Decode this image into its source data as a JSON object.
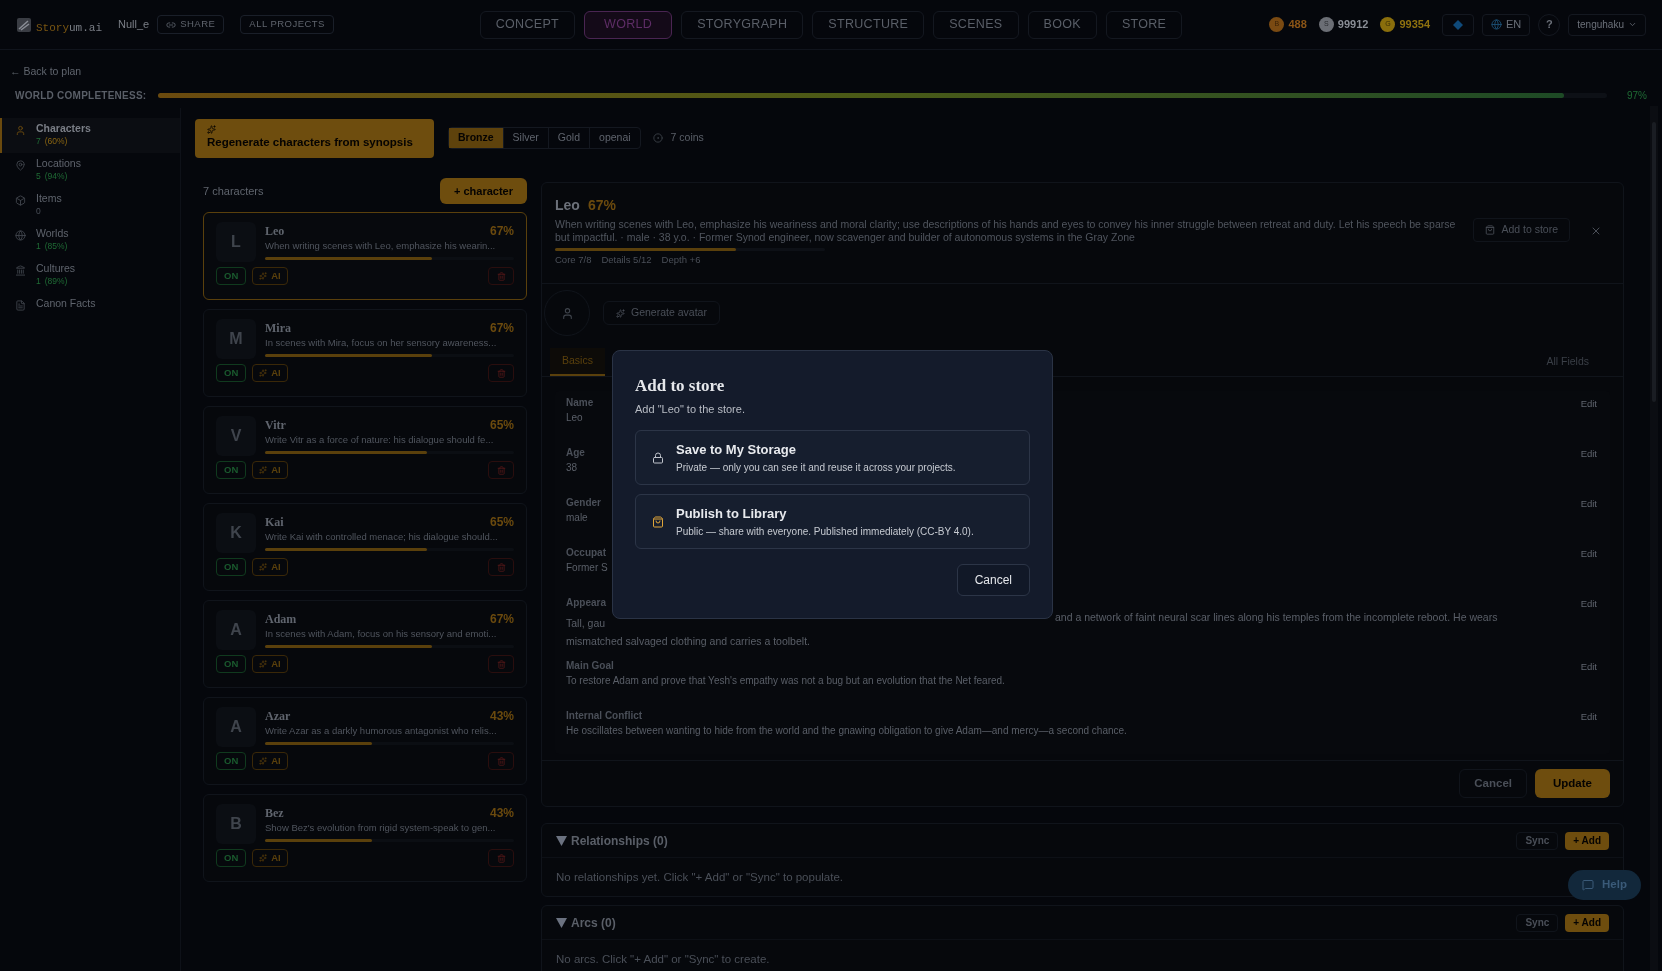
{
  "topbar": {
    "logo": {
      "accent": "Story",
      "rest": "um.ai"
    },
    "project": "Null_e",
    "share": "SHARE",
    "all_projects": "ALL PROJECTS",
    "nav": [
      {
        "label": "CONCEPT",
        "selected": false
      },
      {
        "label": "WORLD",
        "selected": true
      },
      {
        "label": "STORYGRAPH",
        "selected": false
      },
      {
        "label": "STRUCTURE",
        "selected": false
      },
      {
        "label": "SCENES",
        "selected": false
      },
      {
        "label": "BOOK",
        "selected": false
      },
      {
        "label": "STORE",
        "selected": false
      }
    ],
    "coins": [
      {
        "kind": "bronze",
        "letter": "B",
        "amount": "488"
      },
      {
        "kind": "silver",
        "letter": "S",
        "amount": "99912"
      },
      {
        "kind": "gold",
        "letter": "G",
        "amount": "99354"
      }
    ],
    "language": "EN",
    "help": "?",
    "user": "tenguhaku"
  },
  "back_link": "← Back to plan",
  "completeness": {
    "label": "WORLD COMPLETENESS:",
    "level": 0.97,
    "reading": "97%"
  },
  "sidebar": {
    "items": [
      {
        "kind": "characters",
        "label": "Characters",
        "count": "7",
        "percent": "(60%)",
        "selected": true
      },
      {
        "kind": "locations",
        "label": "Locations",
        "count": "5",
        "percent": "(94%)",
        "selected": false
      },
      {
        "kind": "items",
        "label": "Items",
        "count": "0",
        "selected": false
      },
      {
        "kind": "worlds",
        "label": "Worlds",
        "count": "1",
        "percent": "(85%)",
        "selected": false
      },
      {
        "kind": "cultures",
        "label": "Cultures",
        "count": "1",
        "percent": "(89%)",
        "selected": false
      },
      {
        "kind": "canon",
        "label": "Canon Facts",
        "selected": false
      }
    ]
  },
  "toolbar": {
    "regenerate": "Regenerate characters from synopsis",
    "tiers": [
      {
        "label": "Bronze",
        "selected": true
      },
      {
        "label": "Silver",
        "selected": false
      },
      {
        "label": "Gold",
        "selected": false
      },
      {
        "label": "openai",
        "selected": false
      }
    ],
    "cost": "7 coins"
  },
  "list": {
    "count_label": "7 characters",
    "add": "+ character",
    "characters": [
      {
        "initial": "L",
        "name": "Leo",
        "percent": "67%",
        "level": 0.67,
        "summary": "When writing scenes with Leo, emphasize his wearin...",
        "on": true,
        "on_label": "ON",
        "ai_label": "AI",
        "selected": true
      },
      {
        "initial": "M",
        "name": "Mira",
        "percent": "67%",
        "level": 0.67,
        "summary": "In scenes with Mira, focus on her sensory awareness...",
        "on": true,
        "on_label": "ON",
        "ai_label": "AI",
        "selected": false
      },
      {
        "initial": "V",
        "name": "Vitr",
        "percent": "65%",
        "level": 0.65,
        "summary": "Write Vitr as a force of nature: his dialogue should fe...",
        "on": true,
        "on_label": "ON",
        "ai_label": "AI",
        "selected": false
      },
      {
        "initial": "K",
        "name": "Kai",
        "percent": "65%",
        "level": 0.65,
        "summary": "Write Kai with controlled menace; his dialogue should...",
        "on": true,
        "on_label": "ON",
        "ai_label": "AI",
        "selected": false
      },
      {
        "initial": "A",
        "name": "Adam",
        "percent": "67%",
        "level": 0.67,
        "summary": "In scenes with Adam, focus on his sensory and emoti...",
        "on": true,
        "on_label": "ON",
        "ai_label": "AI",
        "selected": false
      },
      {
        "initial": "A",
        "name": "Azar",
        "percent": "43%",
        "level": 0.43,
        "summary": "Write Azar as a darkly humorous antagonist who relis...",
        "on": true,
        "on_label": "ON",
        "ai_label": "AI",
        "selected": false
      },
      {
        "initial": "B",
        "name": "Bez",
        "percent": "43%",
        "level": 0.43,
        "summary": "Show Bez's evolution from rigid system-speak to gen...",
        "on": true,
        "on_label": "ON",
        "ai_label": "AI",
        "selected": false
      }
    ]
  },
  "detail": {
    "name": "Leo",
    "percent": "67%",
    "description": "When writing scenes with Leo, emphasize his weariness and moral clarity; use descriptions of his hands and eyes to convey his inner struggle between retreat and duty. Let his speech be sparse but impactful. · male · 38 y.o. · Former Synod engineer, now scavenger and builder of autonomous systems in the Gray Zone",
    "level": 0.67,
    "stats": [
      "Core 7/8",
      "Details 5/12",
      "Depth +6"
    ],
    "add_to_store": "Add to store",
    "generate_avatar": "Generate avatar",
    "tabs": [
      {
        "label": "Basics",
        "selected": true
      }
    ],
    "all_fields": "All Fields",
    "fields": [
      {
        "kind": "plain",
        "label": "Name",
        "value": "Leo",
        "edit": "Edit"
      },
      {
        "kind": "plain",
        "label": "Age",
        "value": "38",
        "edit": "Edit"
      },
      {
        "kind": "plain",
        "label": "Gender",
        "value": "male",
        "edit": "Edit"
      },
      {
        "kind": "plain",
        "label": "Occupat",
        "value": "Former S",
        "edit": "Edit"
      },
      {
        "kind": "split",
        "label": "Appeara",
        "parts": [
          "Tall, gau",
          "and a network of faint neural scar lines along his temples from the incomplete reboot. He wears",
          "mismatched salvaged clothing and carries a toolbelt."
        ],
        "edit": "Edit"
      },
      {
        "kind": "plain",
        "label": "Main Goal",
        "value": "To restore Adam and prove that Yesh's empathy was not a bug but an evolution that the Net feared.",
        "edit": "Edit"
      },
      {
        "kind": "plain",
        "label": "Internal Conflict",
        "value": "He oscillates between wanting to hide from the world and the gnawing obligation to give Adam—and mercy—a second chance.",
        "edit": "Edit"
      }
    ],
    "cancel": "Cancel",
    "update": "Update"
  },
  "sections": [
    {
      "title": "Relationships (0)",
      "sync": "Sync",
      "add": "+ Add",
      "empty": "No relationships yet. Click \"+ Add\" or \"Sync\" to populate."
    },
    {
      "title": "Arcs (0)",
      "sync": "Sync",
      "add": "+ Add",
      "empty": "No arcs. Click \"+ Add\" or \"Sync\" to create."
    }
  ],
  "help_button": "Help",
  "modal": {
    "title": "Add to store",
    "subtitle": "Add \"Leo\" to the store.",
    "options": [
      {
        "kind": "private",
        "title": "Save to My Storage",
        "description": "Private — only you can see it and reuse it across your projects."
      },
      {
        "kind": "public",
        "title": "Publish to Library",
        "description": "Public — share with everyone. Published immediately (CC-BY 4.0)."
      }
    ],
    "cancel": "Cancel"
  }
}
